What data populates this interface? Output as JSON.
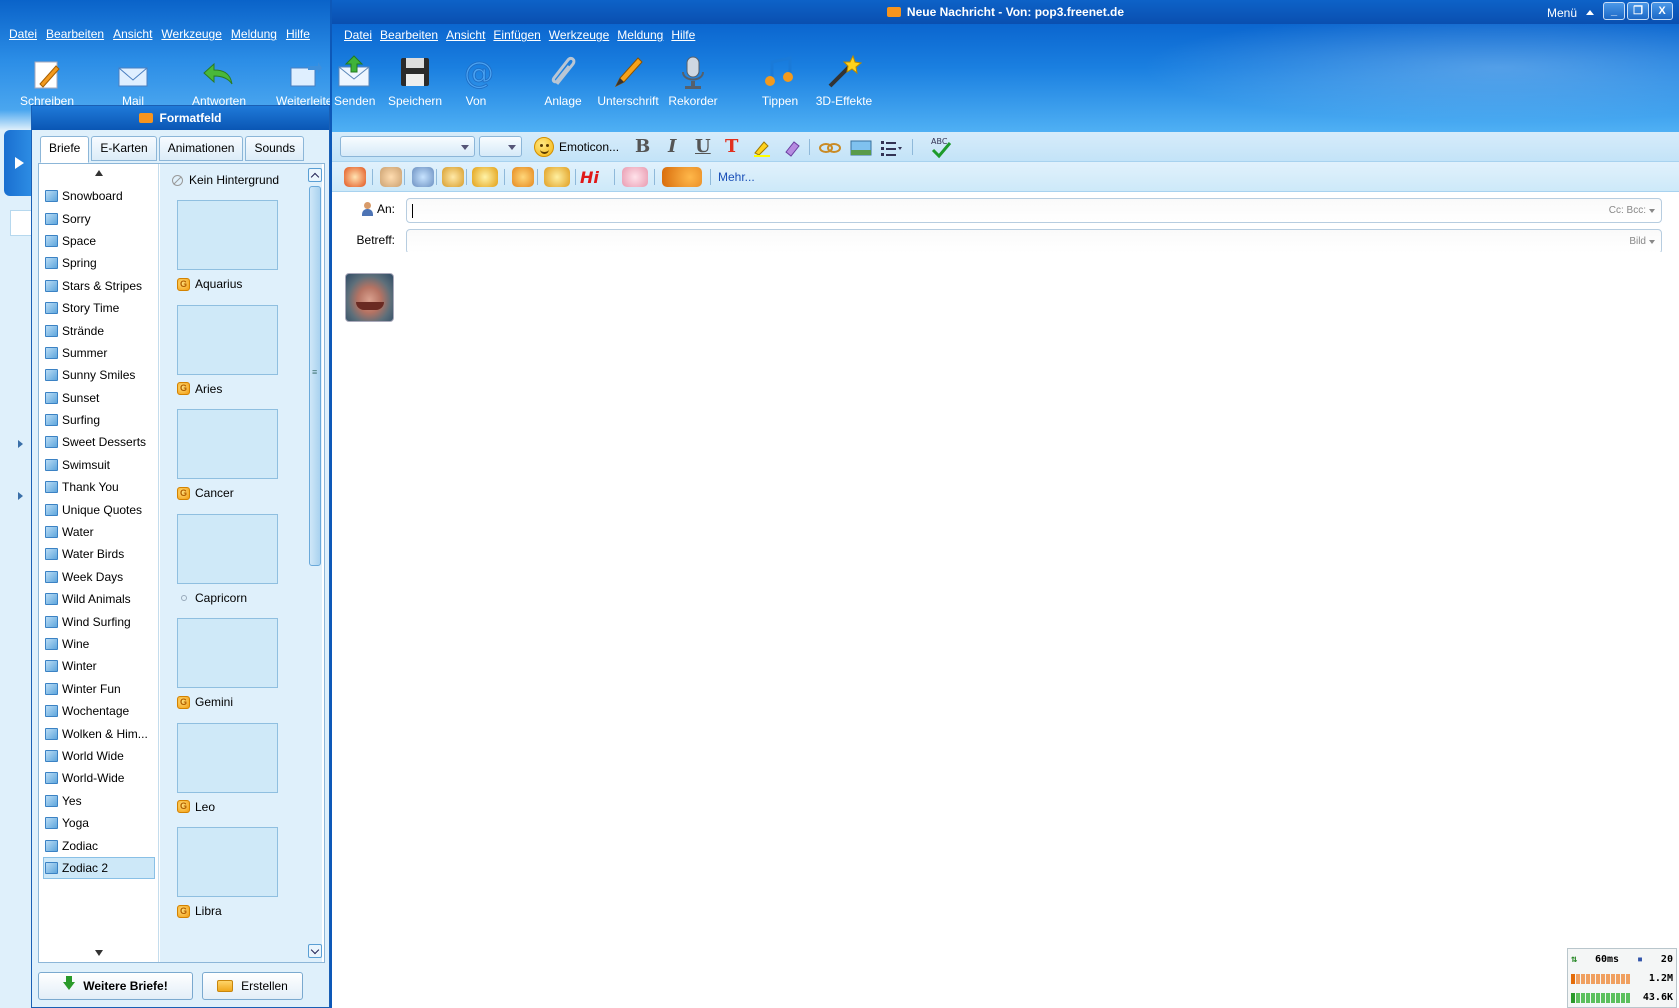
{
  "background_window": {
    "menu": [
      "Datei",
      "Bearbeiten",
      "Ansicht",
      "Werkzeuge",
      "Meldung",
      "Hilfe"
    ],
    "toolbar": [
      "Schreiben",
      "Mail abrufen",
      "Antworten",
      "Weiterleiten"
    ]
  },
  "formatfeld": {
    "title": "Formatfeld",
    "tabs": [
      "Briefe",
      "E-Karten",
      "Animationen",
      "Sounds"
    ],
    "active_tab": "Briefe",
    "list_items": [
      "Snowboard",
      "Sorry",
      "Space",
      "Spring",
      "Stars & Stripes",
      "Story Time",
      "Strände",
      "Summer",
      "Sunny Smiles",
      "Sunset",
      "Surfing",
      "Sweet Desserts",
      "Swimsuit",
      "Thank You",
      "Unique Quotes",
      "Water",
      "Water Birds",
      "Week Days",
      "Wild Animals",
      "Wind Surfing",
      "Wine",
      "Winter",
      "Winter Fun",
      "Wochentage",
      "Wolken & Him...",
      "World Wide",
      "World-Wide",
      "Yes",
      "Yoga",
      "Zodiac",
      "Zodiac 2"
    ],
    "selected_item": "Zodiac 2",
    "no_background": "Kein Hintergrund",
    "thumbnails": [
      {
        "label": "Aquarius",
        "icon": "g-badge-icon"
      },
      {
        "label": "Aries",
        "icon": "g-badge-icon"
      },
      {
        "label": "Cancer",
        "icon": "g-badge-icon"
      },
      {
        "label": "Capricorn",
        "icon": "dot-icon"
      },
      {
        "label": "Gemini",
        "icon": "g-badge-icon"
      },
      {
        "label": "Leo",
        "icon": "g-badge-icon"
      },
      {
        "label": "Libra",
        "icon": "g-badge-icon"
      }
    ],
    "buttons": {
      "more": "Weitere Briefe!",
      "create": "Erstellen"
    }
  },
  "main_window": {
    "title": "Neue Nachricht - Von: pop3.freenet.de",
    "menu_label": "Menü",
    "window_buttons": {
      "minimize": "_",
      "maximize": "❐",
      "close": "X"
    },
    "menu": [
      "Datei",
      "Bearbeiten",
      "Ansicht",
      "Einfügen",
      "Werkzeuge",
      "Meldung",
      "Hilfe"
    ],
    "toolbar": [
      {
        "label": "Senden",
        "icon": "send-envelope-icon"
      },
      {
        "label": "Speichern",
        "icon": "floppy-disk-icon"
      },
      {
        "label": "Von",
        "icon": "at-sign-icon"
      },
      {
        "label": "Anlage",
        "icon": "paperclip-icon"
      },
      {
        "label": "Unterschrift",
        "icon": "pen-icon"
      },
      {
        "label": "Rekorder",
        "icon": "microphone-icon"
      },
      {
        "label": "Tippen",
        "icon": "music-notes-icon"
      },
      {
        "label": "3D-Effekte",
        "icon": "magic-wand-icon"
      }
    ],
    "format": {
      "emoticon_label": "Emoticon...",
      "bold": "B",
      "italic": "I",
      "underline": "U",
      "text_color": "T",
      "mehr_link": "Mehr..."
    },
    "fields": {
      "to_label": "An:",
      "to_value": "",
      "cc_bcc": "Cc: Bcc:",
      "subject_label": "Betreff:",
      "subject_value": "",
      "image_label": "Bild"
    }
  },
  "netmeter": {
    "ping": "60ms",
    "count": "20",
    "download": "1.2M",
    "upload": "43.6K"
  },
  "colors": {
    "titlebar": "#0a56b4",
    "toolbar_gradient_top": "#0b66cf",
    "panel_bg": "#dff0fb",
    "link": "#1a4fb8"
  }
}
